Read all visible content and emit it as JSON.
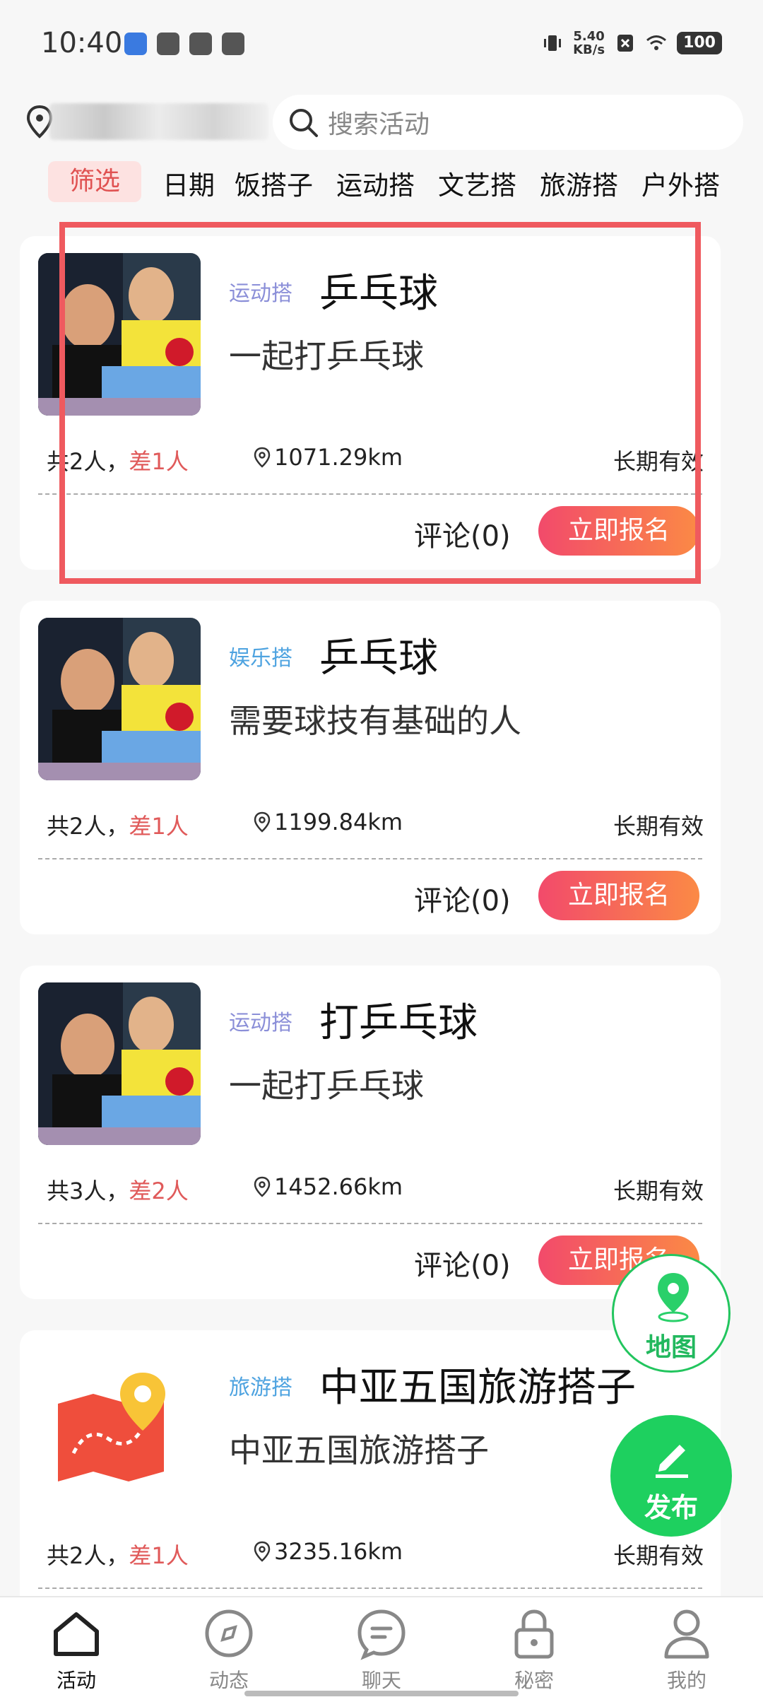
{
  "status_bar": {
    "time": "10:40",
    "net_speed_value": "5.40",
    "net_speed_unit": "KB/s",
    "battery": "100"
  },
  "search": {
    "placeholder": "搜索活动"
  },
  "filter": {
    "chip": "筛选",
    "tabs": [
      "日期",
      "饭搭子",
      "运动搭",
      "文艺搭",
      "旅游搭",
      "户外搭"
    ]
  },
  "cards": [
    {
      "tag": "运动搭",
      "tag_color": "#8b8fd8",
      "title": "乒乓球",
      "desc": "一起打乒乓球",
      "count_total": "共2人，",
      "count_lack": "差1人",
      "distance": "1071.29km",
      "validity": "长期有效",
      "comment": "评论(0)",
      "signup": "立即报名",
      "image": "pingpong-photo"
    },
    {
      "tag": "娱乐搭",
      "tag_color": "#4ea3e0",
      "title": "乒乓球",
      "desc": "需要球技有基础的人",
      "count_total": "共2人，",
      "count_lack": "差1人",
      "distance": "1199.84km",
      "validity": "长期有效",
      "comment": "评论(0)",
      "signup": "立即报名",
      "image": "pingpong-photo"
    },
    {
      "tag": "运动搭",
      "tag_color": "#8b8fd8",
      "title": "打乒乓球",
      "desc": "一起打乒乓球",
      "count_total": "共3人，",
      "count_lack": "差2人",
      "distance": "1452.66km",
      "validity": "长期有效",
      "comment": "评论(0)",
      "signup": "立即报名",
      "image": "pingpong-photo"
    },
    {
      "tag": "旅游搭",
      "tag_color": "#4ea3e0",
      "title": "中亚五国旅游搭子",
      "desc": "中亚五国旅游搭子",
      "count_total": "共2人，",
      "count_lack": "差1人",
      "distance": "3235.16km",
      "validity": "长期有效",
      "comment": "",
      "signup": "",
      "image": "travel-map-icon"
    }
  ],
  "fab": {
    "map_label": "地图",
    "publish_label": "发布"
  },
  "bottom_nav": [
    {
      "label": "活动",
      "icon": "home-icon",
      "active": true
    },
    {
      "label": "动态",
      "icon": "compass-icon",
      "active": false
    },
    {
      "label": "聊天",
      "icon": "chat-icon",
      "active": false
    },
    {
      "label": "秘密",
      "icon": "lock-icon",
      "active": false
    },
    {
      "label": "我的",
      "icon": "user-icon",
      "active": false
    }
  ],
  "colors": {
    "accent_gradient_start": "#f24a6b",
    "accent_gradient_end": "#fb8a45",
    "green": "#1ed05f",
    "filter_red": "#e05252",
    "highlight": "#ef5a5f"
  }
}
